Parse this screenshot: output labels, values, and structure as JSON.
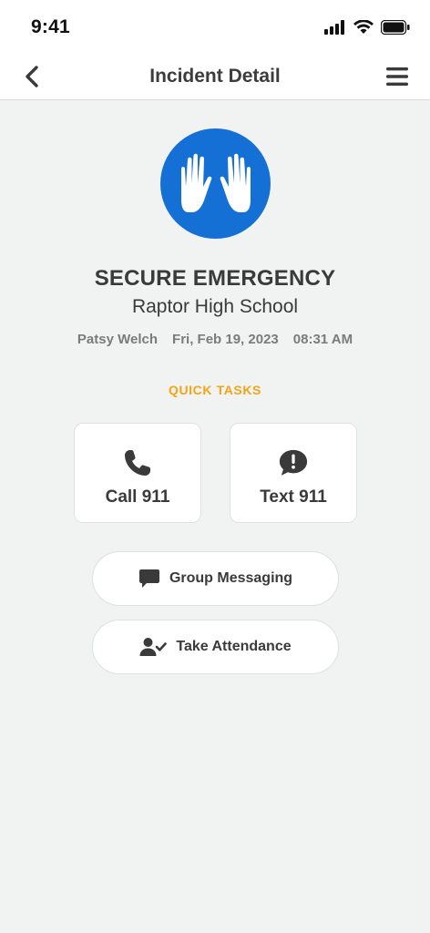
{
  "status_bar": {
    "time": "9:41",
    "icons": [
      "signal-icon",
      "wifi-icon",
      "battery-icon"
    ]
  },
  "nav": {
    "title": "Incident Detail",
    "back_icon": "chevron-left-icon",
    "menu_icon": "hamburger-menu-icon"
  },
  "incident": {
    "icon": "raised-hands-icon",
    "icon_bg": "#1570d6",
    "type": "SECURE EMERGENCY",
    "school": "Raptor High School",
    "reporter": "Patsy Welch",
    "date": "Fri, Feb 19, 2023",
    "time": "08:31 AM"
  },
  "quick_tasks": {
    "label": "QUICK TASKS",
    "label_color": "#f2a516",
    "cards": [
      {
        "label": "Call 911",
        "icon": "phone-icon"
      },
      {
        "label": "Text 911",
        "icon": "message-alert-icon"
      }
    ],
    "buttons": [
      {
        "label": "Group Messaging",
        "icon": "chat-bubble-icon"
      },
      {
        "label": "Take Attendance",
        "icon": "user-check-icon"
      }
    ]
  }
}
